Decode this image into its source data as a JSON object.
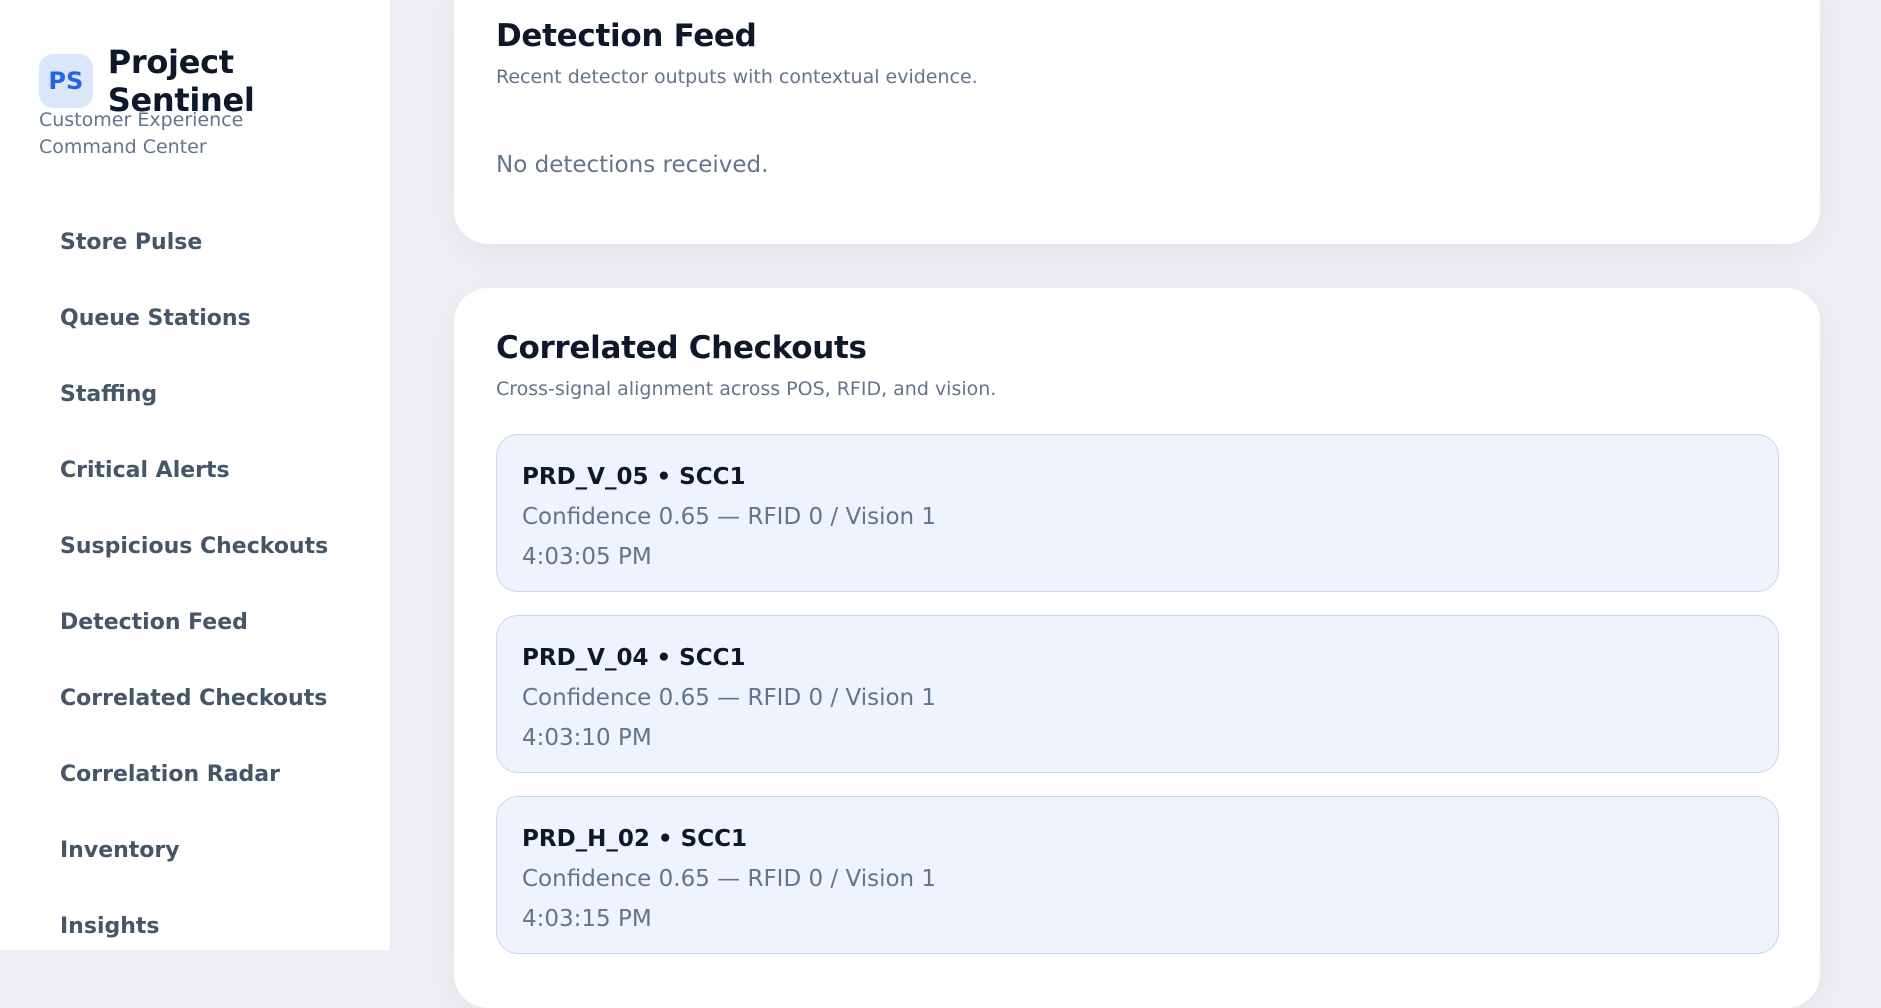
{
  "brand": {
    "logo_text": "PS",
    "title": "Project Sentinel",
    "subtitle": "Customer Experience Command Center"
  },
  "sidebar": {
    "items": [
      {
        "label": "Store Pulse"
      },
      {
        "label": "Queue Stations"
      },
      {
        "label": "Staffing"
      },
      {
        "label": "Critical Alerts"
      },
      {
        "label": "Suspicious Checkouts"
      },
      {
        "label": "Detection Feed"
      },
      {
        "label": "Correlated Checkouts"
      },
      {
        "label": "Correlation Radar"
      },
      {
        "label": "Inventory"
      },
      {
        "label": "Insights"
      }
    ]
  },
  "detection_feed": {
    "title": "Detection Feed",
    "subtitle": "Recent detector outputs with contextual evidence.",
    "empty_text": "No detections received."
  },
  "correlated_checkouts": {
    "title": "Correlated Checkouts",
    "subtitle": "Cross-signal alignment across POS, RFID, and vision.",
    "entries": [
      {
        "title": "PRD_V_05 • SCC1",
        "detail": "Confidence 0.65 — RFID 0 / Vision 1",
        "time": "4:03:05 PM"
      },
      {
        "title": "PRD_V_04 • SCC1",
        "detail": "Confidence 0.65 — RFID 0 / Vision 1",
        "time": "4:03:10 PM"
      },
      {
        "title": "PRD_H_02 • SCC1",
        "detail": "Confidence 0.65 — RFID 0 / Vision 1",
        "time": "4:03:15 PM"
      }
    ]
  }
}
